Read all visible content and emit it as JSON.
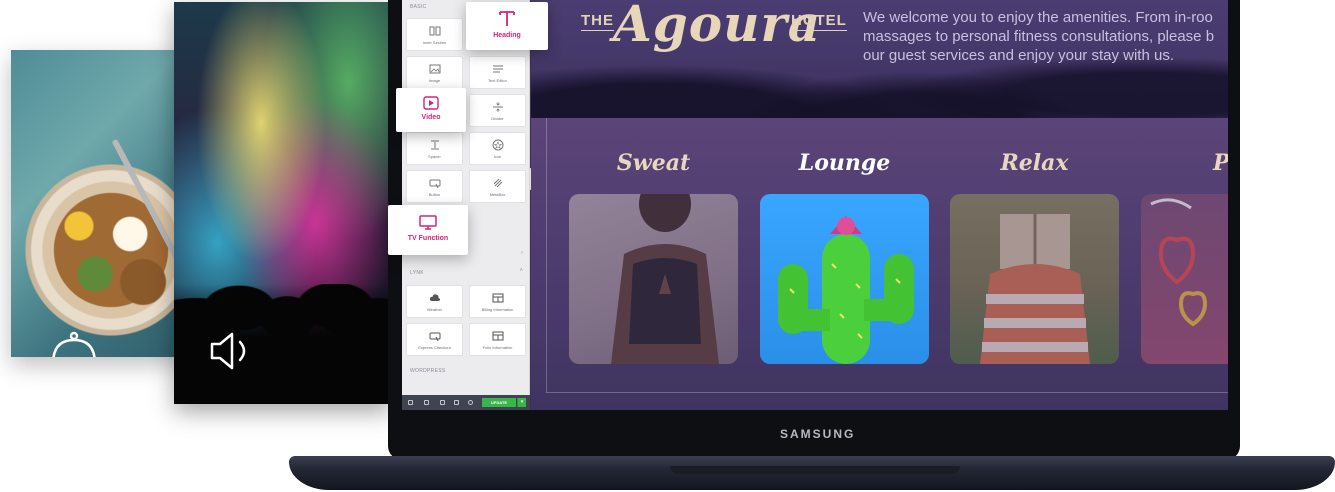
{
  "panel": {
    "section_basic": "BASIC",
    "section_lynk": "LYNK",
    "section_wordpress": "WORDPRESS",
    "widgets": [
      {
        "label": "Inner Section",
        "icon": "inner-section-icon"
      },
      {
        "label": "Image",
        "icon": "image-icon"
      },
      {
        "label": "Text Editor",
        "icon": "text-editor-icon"
      },
      {
        "label": "Divider",
        "icon": "divider-icon"
      },
      {
        "label": "Spacer",
        "icon": "spacer-icon"
      },
      {
        "label": "Icon",
        "icon": "star-icon"
      },
      {
        "label": "Button",
        "icon": "button-icon"
      },
      {
        "label": "MetaBox",
        "icon": "metabox-icon"
      }
    ],
    "lynk_widgets": [
      {
        "label": "Weather",
        "icon": "cloud-icon"
      },
      {
        "label": "Billing Information",
        "icon": "billing-icon"
      },
      {
        "label": "Express Checkout",
        "icon": "checkout-icon"
      },
      {
        "label": "Folio Information",
        "icon": "folio-icon"
      }
    ],
    "update_label": "UPDATE"
  },
  "floating": {
    "heading": "Heading",
    "video": "Video",
    "tv_function": "TV Function"
  },
  "site": {
    "the": "THE",
    "name": "Agoura",
    "hotel": "HOTEL",
    "welcome_lines": [
      "We welcome you to enjoy the amenities. From in-roo",
      "massages to personal fitness consultations, please b",
      "our guest services and enjoy your stay with us."
    ],
    "categories": [
      {
        "title": "Sweat",
        "color": "#e6d7be"
      },
      {
        "title": "Lounge",
        "color": "#ffffff"
      },
      {
        "title": "Relax",
        "color": "#e6d7be"
      },
      {
        "title": "Pl",
        "color": "#e6d7be"
      }
    ]
  },
  "laptop": {
    "brand": "SAMSUNG"
  },
  "colors": {
    "accent": "#d2237a",
    "update_green": "#39b54a",
    "site_purple": "#4a3a6c"
  }
}
